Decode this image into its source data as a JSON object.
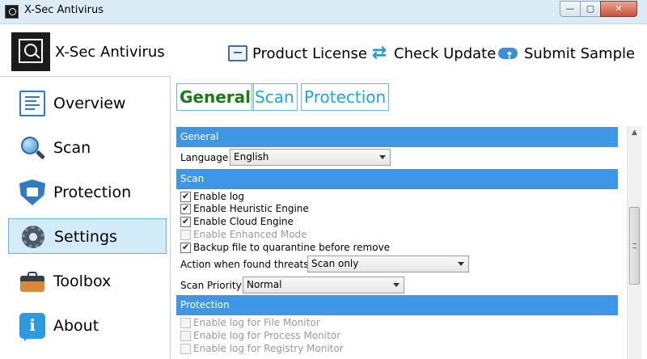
{
  "window": {
    "title": "X-Sec Antivirus",
    "minimize_glyph": "—",
    "maximize_glyph": "▢",
    "close_glyph": "✕"
  },
  "header": {
    "app_name": "X-Sec Antivirus",
    "actions": {
      "license": "Product License",
      "update": "Check Update",
      "submit": "Submit Sample"
    }
  },
  "sidebar": {
    "items": [
      {
        "label": "Overview",
        "icon": "overview-icon"
      },
      {
        "label": "Scan",
        "icon": "magnifier-icon"
      },
      {
        "label": "Protection",
        "icon": "shield-icon"
      },
      {
        "label": "Settings",
        "icon": "gear-icon",
        "active": true
      },
      {
        "label": "Toolbox",
        "icon": "toolbox-icon"
      },
      {
        "label": "About",
        "icon": "info-icon"
      }
    ]
  },
  "tabs": [
    {
      "label": "General",
      "active": true
    },
    {
      "label": "Scan"
    },
    {
      "label": "Protection"
    }
  ],
  "sections": {
    "general": {
      "header": "General",
      "language_label": "Language",
      "language_value": "English"
    },
    "scan": {
      "header": "Scan",
      "options": [
        {
          "label": "Enable log",
          "checked": true,
          "enabled": true
        },
        {
          "label": "Enable Heuristic Engine",
          "checked": true,
          "enabled": true
        },
        {
          "label": "Enable Cloud Engine",
          "checked": true,
          "enabled": true
        },
        {
          "label": "Enable Enhanced Mode",
          "checked": false,
          "enabled": false
        },
        {
          "label": "Backup file to quarantine before remove",
          "checked": true,
          "enabled": true
        }
      ],
      "action_label": "Action when found threats",
      "action_value": "Scan only",
      "priority_label": "Scan Priority",
      "priority_value": "Normal"
    },
    "protection": {
      "header": "Protection",
      "options": [
        {
          "label": "Enable log for File Monitor",
          "checked": false,
          "enabled": false
        },
        {
          "label": "Enable log for Process Monitor",
          "checked": false,
          "enabled": false
        },
        {
          "label": "Enable log for Registry Monitor",
          "checked": false,
          "enabled": false
        }
      ]
    }
  },
  "colors": {
    "section_header": "#3e97e6",
    "tab_active_text": "#1b7a1b",
    "tab_text": "#1fa6e0",
    "nav_active_bg": "#d4ecfa"
  }
}
